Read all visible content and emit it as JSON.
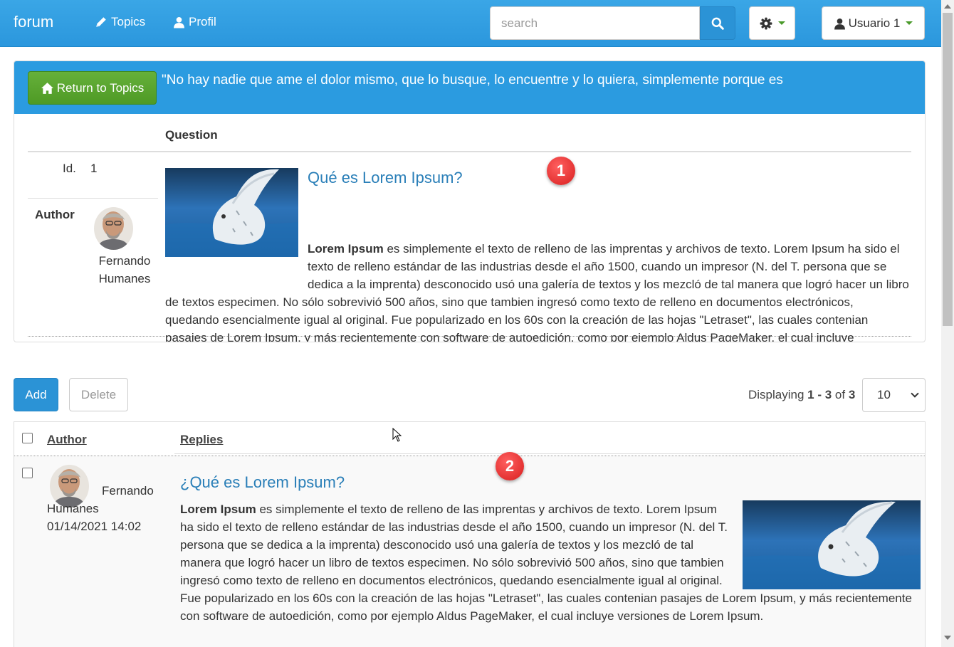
{
  "navbar": {
    "brand": "forum",
    "links": [
      {
        "label": "Topics",
        "icon": "pencil-icon"
      },
      {
        "label": "Profil",
        "icon": "user-icon"
      }
    ],
    "search_placeholder": "search",
    "user_label": "Usuario 1"
  },
  "question_panel": {
    "return_label": "Return to Topics",
    "quote": "\"No hay nadie que ame el dolor mismo, que lo busque, lo encuentre y lo quiera, simplemente porque es",
    "column_header": "Question",
    "id_label": "Id.",
    "id_value": "1",
    "author_label": "Author",
    "author_first": "Fernando",
    "author_last": "Humanes",
    "title": "Qué es Lorem Ipsum?",
    "body_bold": "Lorem Ipsum",
    "body_text": " es simplemente el texto de relleno de las imprentas y archivos de texto. Lorem Ipsum ha sido el texto de relleno estándar de las industrias desde el año 1500, cuando un impresor (N. del T. persona que se dedica a la imprenta) desconocido usó una galería de textos y los mezcló de tal manera que logró hacer un libro de textos especimen. No sólo sobrevivió 500 años, sino que tambien ingresó como texto de relleno en documentos electrónicos, quedando esencialmente igual al original. Fue popularizado en los 60s con la creación de las hojas \"Letraset\", las cuales contenian pasajes de Lorem Ipsum, y más recientemente con software de autoedición, como por ejemplo Aldus PageMaker, el cual incluye versiones de Lorem Ipsum.",
    "badge": "1"
  },
  "toolbar": {
    "add_label": "Add",
    "delete_label": "Delete",
    "displaying_prefix": "Displaying ",
    "range_start": "1",
    "range_sep": " - ",
    "range_end": "3",
    "of_label": " of ",
    "total": "3",
    "per_page": "10"
  },
  "replies_table": {
    "headers": [
      "Author",
      "Replies"
    ],
    "badge": "2",
    "rows": [
      {
        "author_first": "Fernando",
        "author_last": "Humanes",
        "date": "01/14/2021 14:02",
        "title": "¿Qué es Lorem Ipsum?",
        "body_bold": "Lorem Ipsum",
        "body_text": " es simplemente el texto de relleno de las imprentas y archivos de texto. Lorem Ipsum ha sido el texto de relleno estándar de las industrias desde el año 1500, cuando un impresor (N. del T. persona que se dedica a la imprenta) desconocido usó una galería de textos y los mezcló de tal manera que logró hacer un libro de textos especimen. No sólo sobrevivió 500 años, sino que tambien ingresó como texto de relleno en documentos electrónicos, quedando esencialmente igual al original. Fue popularizado en los 60s con la creación de las hojas \"Letraset\", las cuales contenian pasajes de Lorem Ipsum, y más recientemente con software de autoedición, como por ejemplo Aldus PageMaker, el cual incluye versiones de Lorem Ipsum."
      }
    ]
  },
  "colors": {
    "navbar": "#2b97dd",
    "accent": "#2a7fb8",
    "success": "#4e9a25",
    "badge": "#d81e1e"
  }
}
